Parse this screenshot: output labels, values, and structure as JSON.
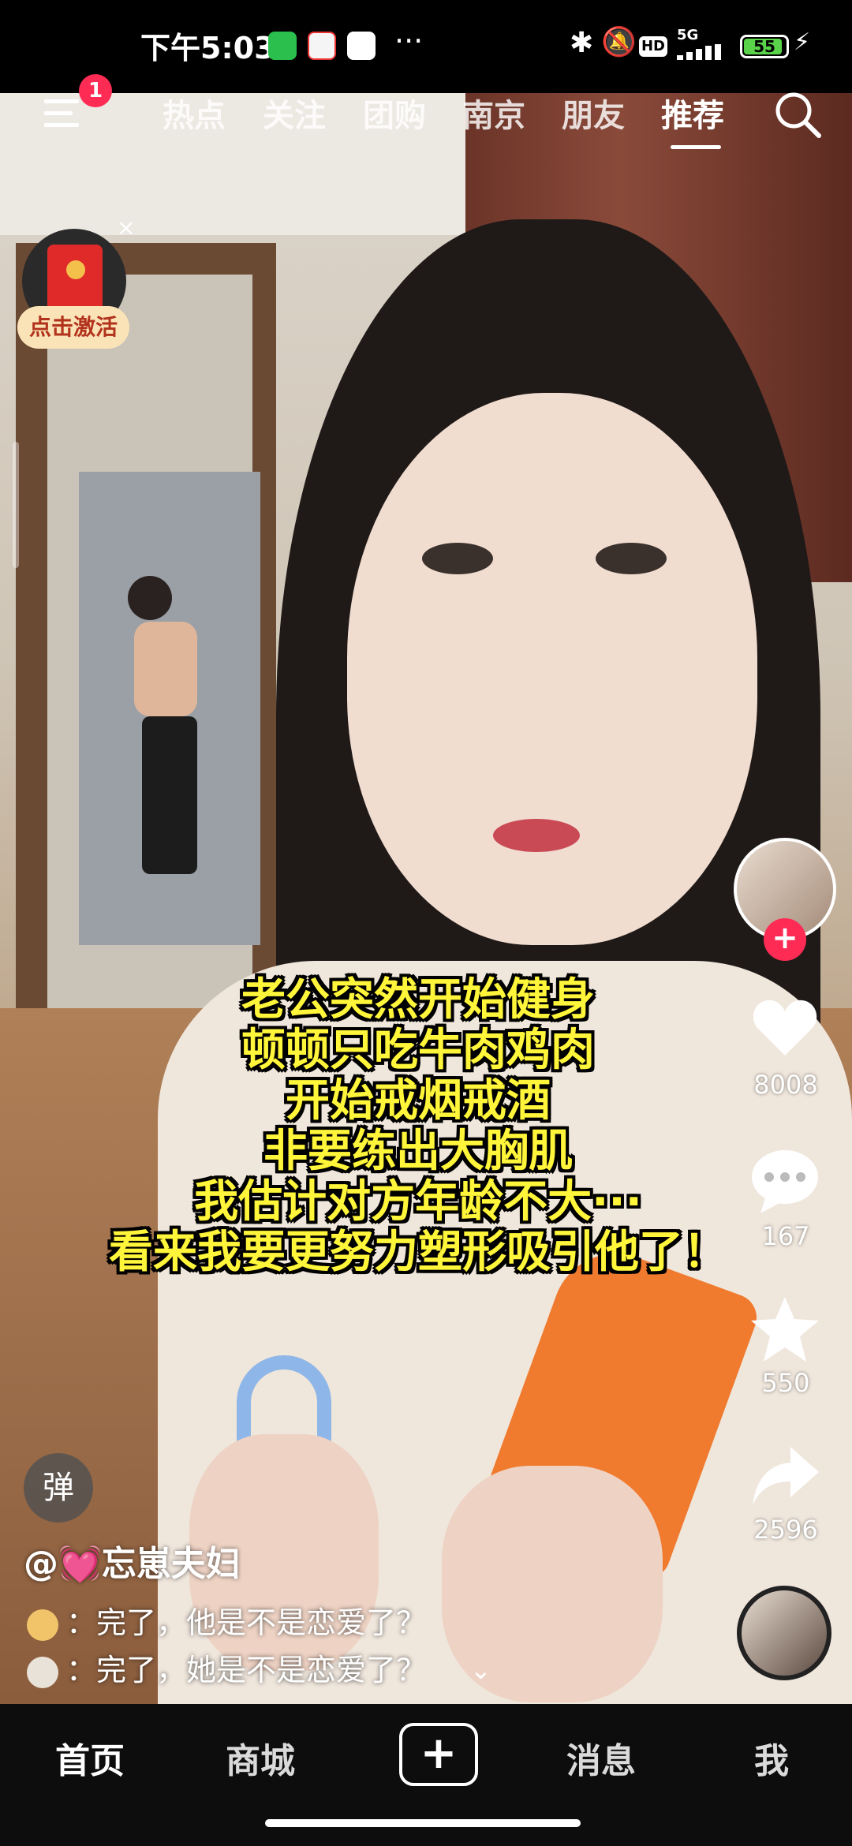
{
  "status_bar": {
    "time": "下午5:03",
    "more": "···",
    "network": "5G",
    "hd": "HD",
    "battery": "55"
  },
  "top_nav": {
    "tabs": [
      "热点",
      "关注",
      "团购",
      "南京",
      "朋友",
      "推荐"
    ],
    "active_tab": "推荐",
    "menu_badge": "1"
  },
  "red_packet": {
    "label": "点击激活",
    "close": "×"
  },
  "caption": {
    "lines": [
      "老公突然开始健身",
      "顿顿只吃牛肉鸡肉",
      "开始戒烟戒酒",
      "非要练出大胸肌",
      "我估计对方年龄不大···",
      "看来我要更努力塑形吸引他了！"
    ]
  },
  "actions": {
    "likes": "8008",
    "comments": "167",
    "favorites": "550",
    "shares": "2596",
    "follow": "+"
  },
  "danmaku": "弹",
  "author": "@💓忘崽夫妇",
  "comments": [
    {
      "text": "：完了，他是不是恋爱了？",
      "avatar_color": "#f2c46a"
    },
    {
      "text": "：完了，她是不是恋爱了？",
      "avatar_color": "#e9e2d8"
    }
  ],
  "bottom_nav": {
    "home": "首页",
    "mall": "商城",
    "add": "+",
    "messages": "消息",
    "me": "我"
  },
  "colors": {
    "accent": "#fe2c55",
    "caption": "#fff53a"
  }
}
